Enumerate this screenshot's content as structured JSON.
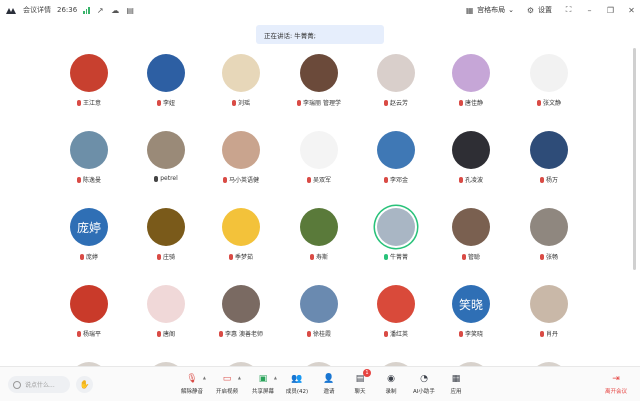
{
  "titlebar": {
    "meeting_details": "会议详情",
    "duration": "26:36",
    "layout_label": "宫格布局",
    "settings_label": "设置"
  },
  "speaking": {
    "text": "正在讲话: 牛菁菁;"
  },
  "participants": [
    {
      "name": "王江意",
      "mic": "off",
      "bg": "#c8402f",
      "glyph": ""
    },
    {
      "name": "李妞",
      "mic": "off",
      "bg": "#2d5fa3",
      "glyph": ""
    },
    {
      "name": "刘瑶",
      "mic": "off",
      "bg": "#e7d7b9",
      "glyph": ""
    },
    {
      "name": "李瑞丽 管理学",
      "mic": "off",
      "bg": "#6b4a3a",
      "glyph": ""
    },
    {
      "name": "赵云芳",
      "mic": "off",
      "bg": "#d9cfcb",
      "glyph": ""
    },
    {
      "name": "唐佳静",
      "mic": "off",
      "bg": "#c6a6d7",
      "glyph": ""
    },
    {
      "name": "张文静",
      "mic": "off",
      "bg": "#f2f2f2",
      "glyph": ""
    },
    {
      "name": "陈逸曼",
      "mic": "off",
      "bg": "#6d8fa8",
      "glyph": ""
    },
    {
      "name": "petrel",
      "mic": "on",
      "bg": "#9a8a78",
      "glyph": ""
    },
    {
      "name": "马小英语健",
      "mic": "off",
      "bg": "#c9a48e",
      "glyph": ""
    },
    {
      "name": "吴双军",
      "mic": "off",
      "bg": "#f4f4f4",
      "glyph": ""
    },
    {
      "name": "李邓金",
      "mic": "off",
      "bg": "#3f78b5",
      "glyph": ""
    },
    {
      "name": "孔凌波",
      "mic": "off",
      "bg": "#2e2e34",
      "glyph": ""
    },
    {
      "name": "杨万",
      "mic": "off",
      "bg": "#2e4c78",
      "glyph": ""
    },
    {
      "name": "庞婷",
      "mic": "off",
      "bg": "#2f6fb5",
      "glyph": "庞婷"
    },
    {
      "name": "庄骑",
      "mic": "off",
      "bg": "#7a5a1a",
      "glyph": ""
    },
    {
      "name": "季梦茹",
      "mic": "off",
      "bg": "#f3c23a",
      "glyph": ""
    },
    {
      "name": "寿斯",
      "mic": "off",
      "bg": "#5a7a3a",
      "glyph": ""
    },
    {
      "name": "牛菁菁",
      "mic": "green",
      "bg": "#a9b6c4",
      "glyph": ""
    },
    {
      "name": "管聪",
      "mic": "off",
      "bg": "#7a6050",
      "glyph": ""
    },
    {
      "name": "张畅",
      "mic": "off",
      "bg": "#8f877f",
      "glyph": ""
    },
    {
      "name": "杨瑞平",
      "mic": "off",
      "bg": "#c93a2a",
      "glyph": ""
    },
    {
      "name": "唐阁",
      "mic": "off",
      "bg": "#f0d8d8",
      "glyph": ""
    },
    {
      "name": "李惠 澳善老师",
      "mic": "off",
      "bg": "#7a6a62",
      "glyph": ""
    },
    {
      "name": "徐桂霞",
      "mic": "off",
      "bg": "#6a8ab0",
      "glyph": ""
    },
    {
      "name": "潘红英",
      "mic": "off",
      "bg": "#d94a3a",
      "glyph": ""
    },
    {
      "name": "李笑晓",
      "mic": "off",
      "bg": "#2f6fb5",
      "glyph": "笑晓"
    },
    {
      "name": "肖丹",
      "mic": "off",
      "bg": "#c9b8a8",
      "glyph": ""
    }
  ],
  "chat": {
    "placeholder": "说点什么..."
  },
  "toolbar": {
    "mute": "解除静音",
    "video": "开启视频",
    "share": "共享屏幕",
    "members": "成员(42)",
    "invite": "邀请",
    "chat": "聊天",
    "chat_badge": "1",
    "record": "录制",
    "ai": "AI小助手",
    "apps": "应用",
    "leave": "离开会议"
  },
  "colors": {
    "accent": "#1f6fe5",
    "danger": "#e64340",
    "speaking_ring": "#29c27a"
  }
}
